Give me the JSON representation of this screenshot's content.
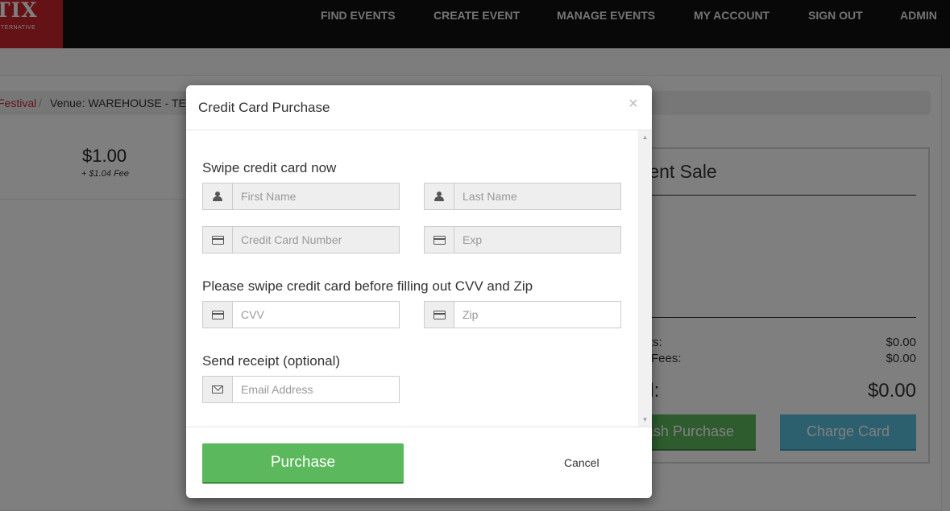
{
  "nav": {
    "logo_main": "TIX",
    "logo_sub": "TERNATIVE",
    "items": [
      {
        "label": "FIND EVENTS"
      },
      {
        "label": "CREATE EVENT"
      },
      {
        "label": "MANAGE EVENTS"
      },
      {
        "label": "MY ACCOUNT"
      },
      {
        "label": "SIGN OUT"
      },
      {
        "label": "ADMIN"
      }
    ]
  },
  "breadcrumb": {
    "event_link": "Festival",
    "separator": "/",
    "venue": "Venue: WAREHOUSE - TEST"
  },
  "ticket": {
    "price": "$1.00",
    "fee": "+ $1.04 Fee"
  },
  "sale": {
    "title": "rrent Sale",
    "tickets_label": "ts:",
    "tickets_value": "$0.00",
    "fees_label": "Fees:",
    "fees_value": "$0.00",
    "total_label": "al:",
    "total_value": "$0.00",
    "cash_button": "Cash Purchase",
    "charge_button": "Charge Card"
  },
  "modal": {
    "title": "Credit Card Purchase",
    "close": "×",
    "swipe_label": "Swipe credit card now",
    "first_name_placeholder": "First Name",
    "last_name_placeholder": "Last Name",
    "card_number_placeholder": "Credit Card Number",
    "exp_placeholder": "Exp",
    "swipe_before_label": "Please swipe credit card before filling out CVV and Zip",
    "cvv_placeholder": "CVV",
    "zip_placeholder": "Zip",
    "receipt_label": "Send receipt (optional)",
    "email_placeholder": "Email Address",
    "purchase_button": "Purchase",
    "cancel_button": "Cancel"
  }
}
